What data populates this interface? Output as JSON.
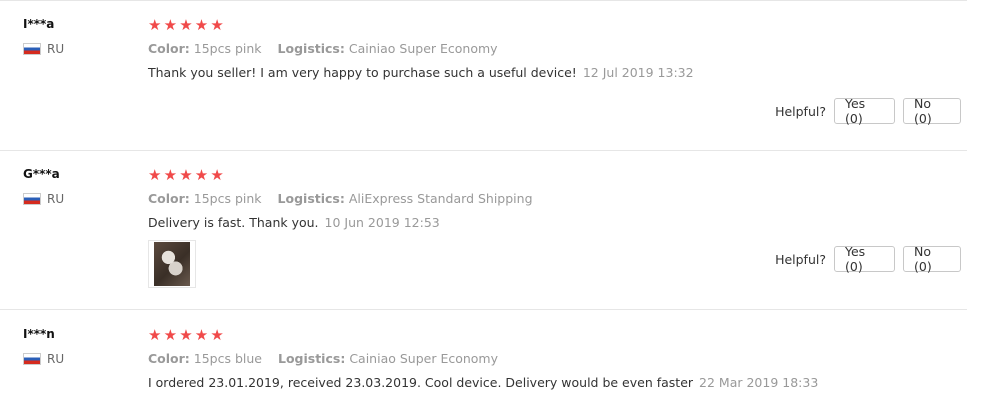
{
  "helpful_label": "Helpful?",
  "star_glyph": "★",
  "colors": {
    "star": "#f04a4a",
    "muted": "#999999",
    "text": "#333333",
    "border": "#e6e6e6"
  },
  "reviews": [
    {
      "username": "I***a",
      "country": "RU",
      "rating": 5,
      "color_label": "Color:",
      "color_value": "15pcs pink",
      "logistics_label": "Logistics:",
      "logistics_value": "Cainiao Super Economy",
      "text": "Thank you seller! I am very happy to purchase such a useful device!",
      "date": "12 Jul 2019 13:32",
      "has_photo": false,
      "yes_label": "Yes (0)",
      "no_label": "No (0)"
    },
    {
      "username": "G***a",
      "country": "RU",
      "rating": 5,
      "color_label": "Color:",
      "color_value": "15pcs pink",
      "logistics_label": "Logistics:",
      "logistics_value": "AliExpress Standard Shipping",
      "text": "Delivery is fast. Thank you.",
      "date": "10 Jun 2019 12:53",
      "has_photo": true,
      "yes_label": "Yes (0)",
      "no_label": "No (0)"
    },
    {
      "username": "I***n",
      "country": "RU",
      "rating": 5,
      "color_label": "Color:",
      "color_value": "15pcs blue",
      "logistics_label": "Logistics:",
      "logistics_value": "Cainiao Super Economy",
      "text": "I ordered 23.01.2019, received 23.03.2019. Cool device. Delivery would be even faster",
      "date": "22 Mar 2019 18:33",
      "has_photo": false
    }
  ]
}
